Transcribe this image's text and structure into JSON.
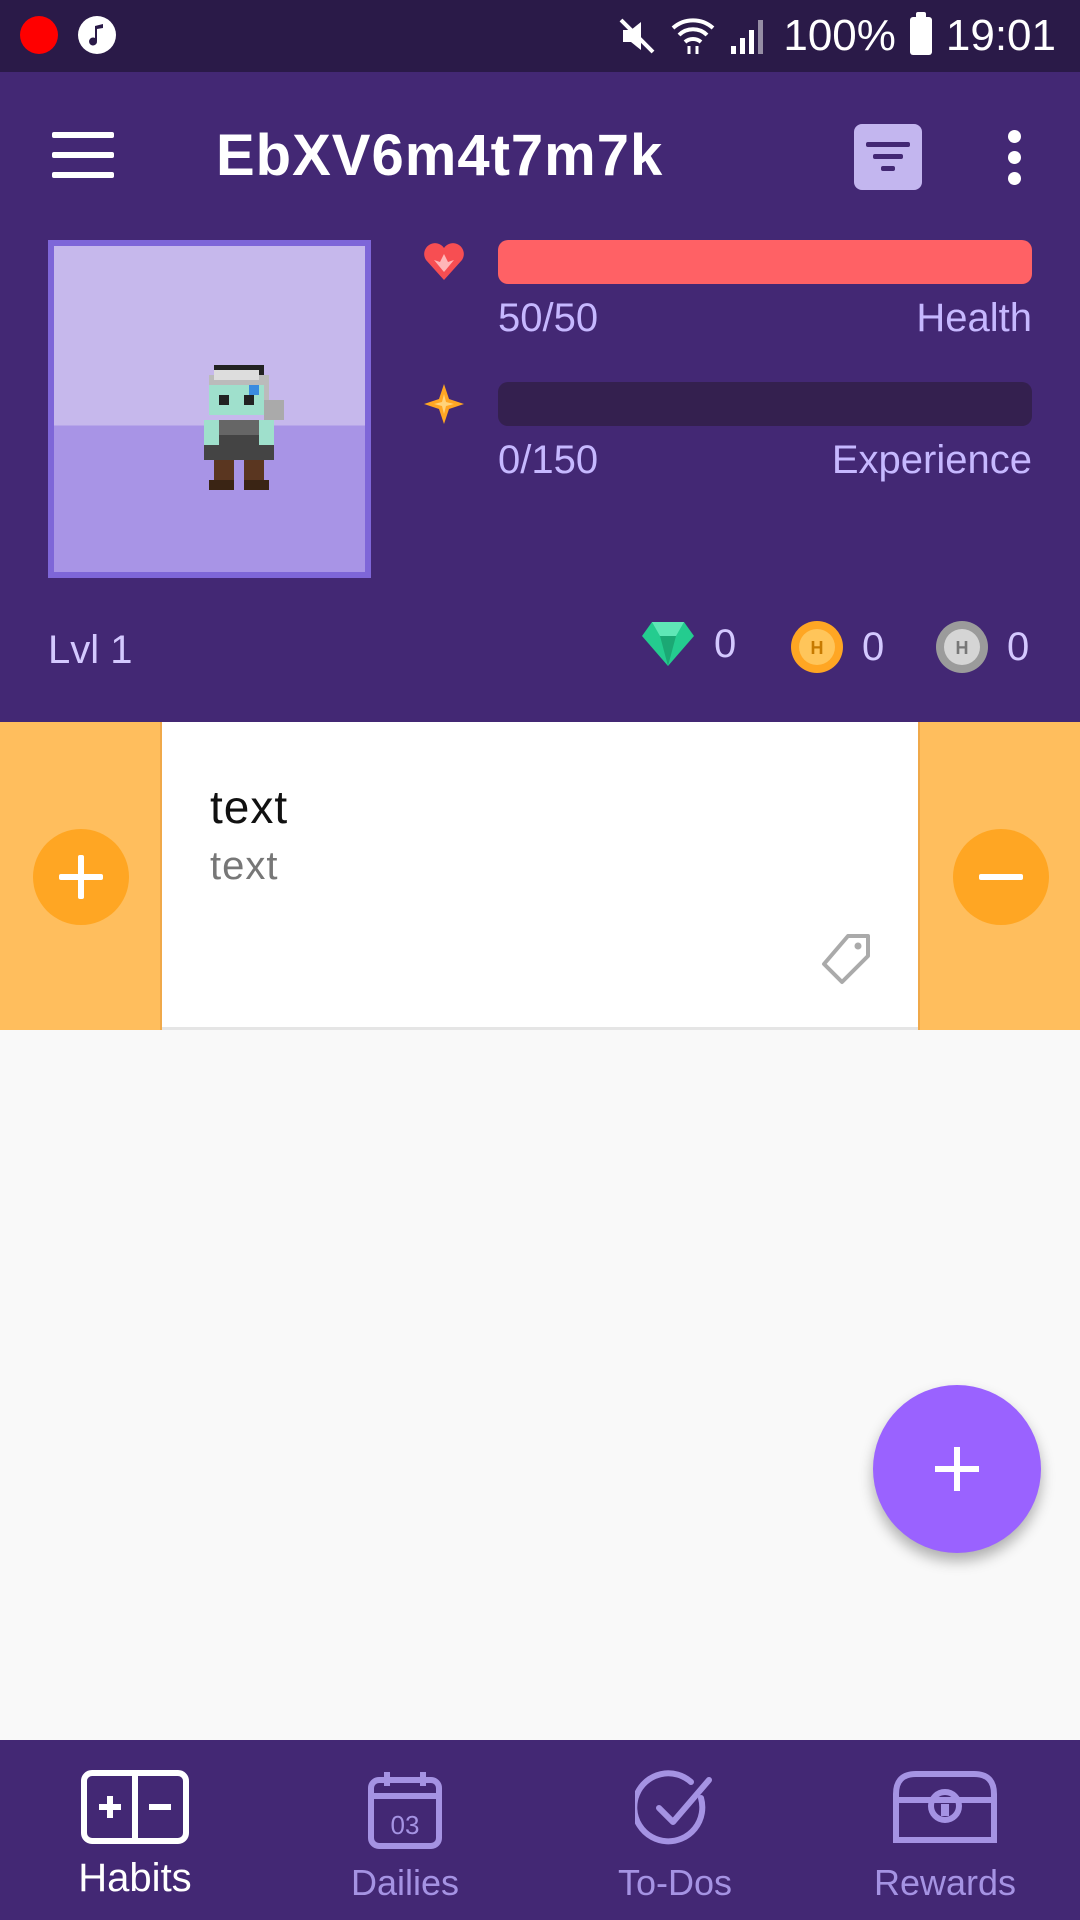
{
  "status_bar": {
    "battery": "100%",
    "time": "19:01"
  },
  "header": {
    "title": "EbXV6m4t7m7k",
    "stats": {
      "health": {
        "value": "50/50",
        "label": "Health",
        "fraction": 1.0,
        "color": "#ff6165"
      },
      "experience": {
        "value": "0/150",
        "label": "Experience",
        "fraction": 0.0,
        "color": "#34204f"
      }
    },
    "level": "Lvl 1",
    "currencies": {
      "gems": "0",
      "gold": "0",
      "hourglasses": "0"
    }
  },
  "tasks": [
    {
      "title": "text",
      "notes": "text"
    }
  ],
  "nav": {
    "habits": "Habits",
    "dailies": "Dailies",
    "dailies_icon_number": "03",
    "todos": "To-Dos",
    "rewards": "Rewards"
  },
  "colors": {
    "header_bg": "#432874",
    "accent": "#9a62ff",
    "habit_side": "#ffbe5d",
    "habit_button": "#ffa623"
  }
}
